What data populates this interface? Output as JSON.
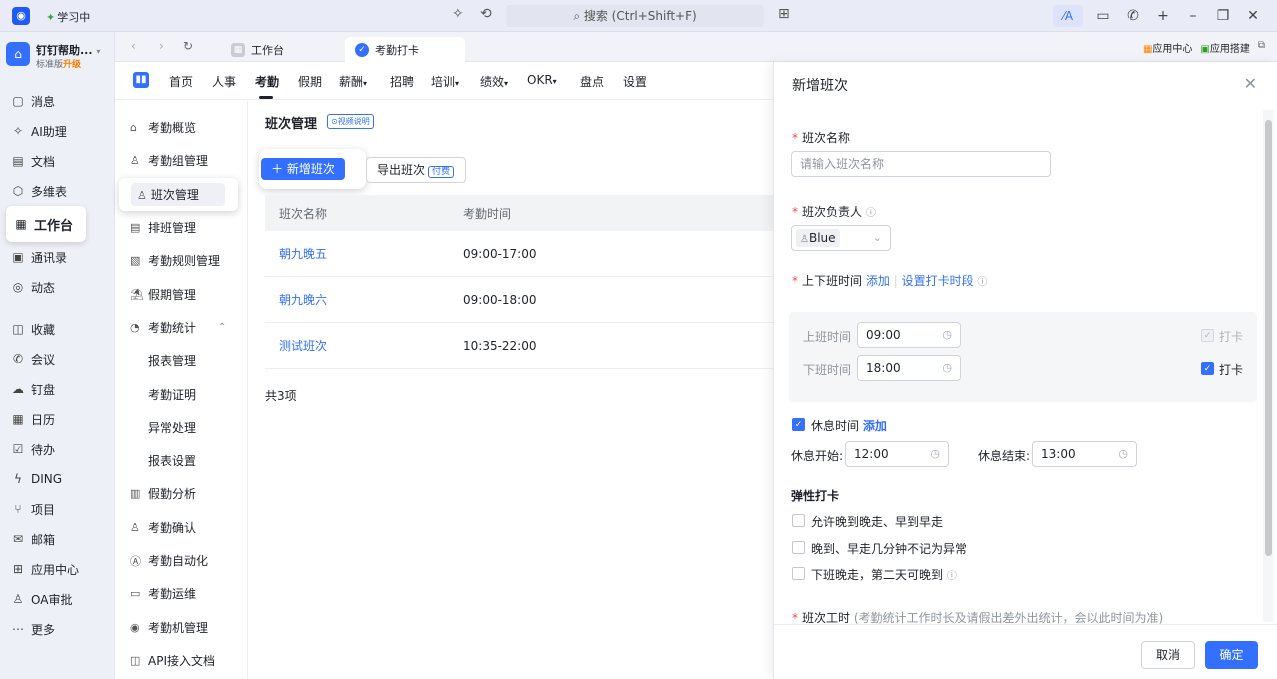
{
  "titlebar": {
    "status": "学习中",
    "search": "搜索 (Ctrl+Shift+F)"
  },
  "org": {
    "name": "钉钉帮助...",
    "edition": "标准版",
    "upgrade": "升级"
  },
  "nav": {
    "items": [
      "消息",
      "AI助理",
      "文档",
      "多维表",
      "工作台",
      "通讯录",
      "动态",
      "收藏",
      "会议",
      "钉盘",
      "日历",
      "待办",
      "DING",
      "项目",
      "邮箱",
      "应用中心",
      "OA审批",
      "更多"
    ]
  },
  "tabs": {
    "items": [
      "工作台",
      "考勤打卡"
    ],
    "app_center": "应用中心",
    "app_build": "应用搭建"
  },
  "topnav": {
    "items": [
      "首页",
      "人事",
      "考勤",
      "假期",
      "薪酬",
      "招聘",
      "培训",
      "绩效",
      "OKR",
      "盘点",
      "设置"
    ]
  },
  "submenu": {
    "items": [
      "考勤概览",
      "考勤组管理",
      "班次管理",
      "排班管理",
      "考勤规则管理",
      "假期管理",
      "考勤统计",
      "报表管理",
      "考勤证明",
      "异常处理",
      "报表设置",
      "假勤分析",
      "考勤确认",
      "考勤自动化",
      "考勤运维",
      "考勤机管理",
      "API接入文档"
    ]
  },
  "content": {
    "title": "班次管理",
    "video_badge": "视频说明",
    "add_button": "新增班次",
    "export_button": "导出班次",
    "paid_badge": "付费",
    "table": {
      "headers": [
        "班次名称",
        "考勤时间"
      ],
      "rows": [
        {
          "name": "朝九晚五",
          "time": "09:00-17:00"
        },
        {
          "name": "朝九晚六",
          "time": "09:00-18:00"
        },
        {
          "name": "测试班次",
          "time": "10:35-22:00"
        }
      ]
    },
    "total": "共3项"
  },
  "panel": {
    "title": "新增班次",
    "shift_name_label": "班次名称",
    "shift_name_placeholder": "请输入班次名称",
    "owner_label": "班次负责人",
    "owner_value": "Blue",
    "work_time_label": "上下班时间",
    "add_link": "添加",
    "set_punch_link": "设置打卡时段",
    "on_label": "上班时间",
    "on_time": "09:00",
    "off_label": "下班时间",
    "off_time": "18:00",
    "punch": "打卡",
    "rest_label": "休息时间",
    "rest_add": "添加",
    "rest_start_label": "休息开始:",
    "rest_start": "12:00",
    "rest_end_label": "休息结束:",
    "rest_end": "13:00",
    "flex_title": "弹性打卡",
    "flex_1": "允许晚到晚走、早到早走",
    "flex_2": "晚到、早走几分钟不记为异常",
    "flex_3": "下班晚走，第二天可晚到",
    "hours_label": "班次工时",
    "hours_hint": "(考勤统计工作时长及请假出差外出统计，会以此时间为准)",
    "cancel": "取消",
    "ok": "确定"
  }
}
